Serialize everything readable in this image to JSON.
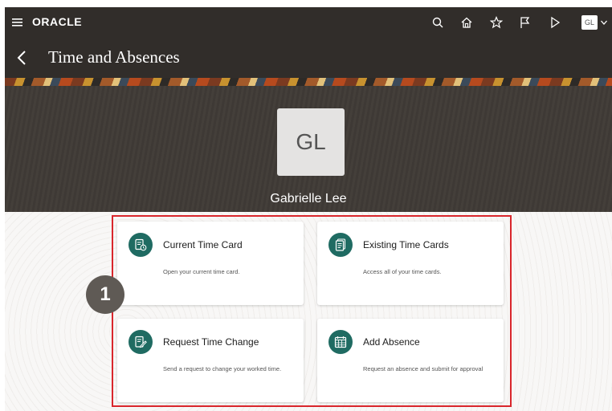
{
  "header": {
    "logo": "ORACLE",
    "avatar_initials": "GL"
  },
  "page": {
    "title": "Time and Absences"
  },
  "profile": {
    "initials": "GL",
    "name": "Gabrielle Lee"
  },
  "callout": {
    "number": "1"
  },
  "cards": [
    {
      "title": "Current Time Card",
      "description": "Open your current time card.",
      "icon": "time-card-clock-icon"
    },
    {
      "title": "Existing Time Cards",
      "description": "Access all of your time cards.",
      "icon": "time-cards-stack-icon"
    },
    {
      "title": "Request Time Change",
      "description": "Send a request to change your worked time.",
      "icon": "document-edit-icon"
    },
    {
      "title": "Add Absence",
      "description": "Request an absence and submit for approval",
      "icon": "calendar-icon"
    }
  ],
  "colors": {
    "header_bg": "#312d2a",
    "card_icon_bg": "#1f6b62",
    "highlight_border": "#d9262c",
    "callout_bg": "#5f5a55"
  }
}
